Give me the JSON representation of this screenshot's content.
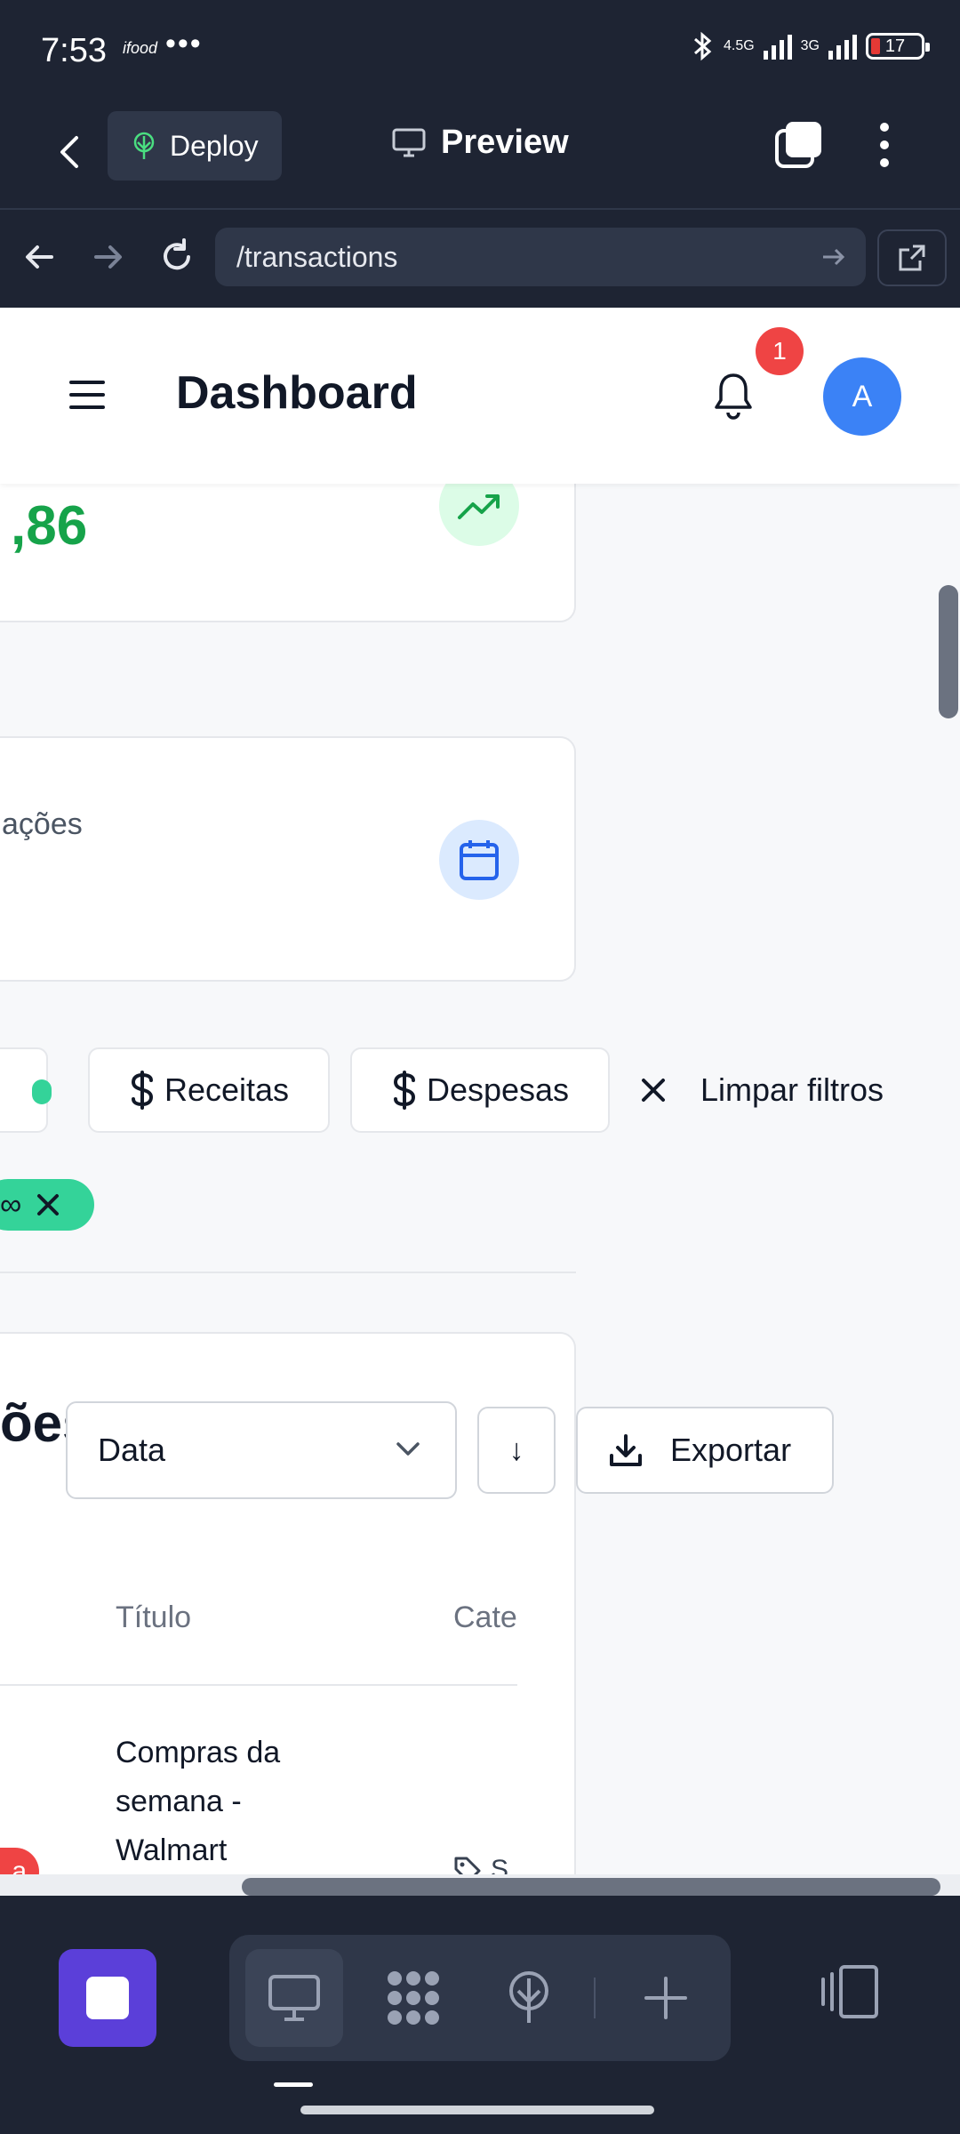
{
  "status_bar": {
    "time": "7:53",
    "app_icon_label": "ifood",
    "more": "•••",
    "network_1": "4.5G",
    "network_2": "3G",
    "battery": "17"
  },
  "toolbar": {
    "deploy_label": "Deploy",
    "preview_label": "Preview"
  },
  "browser": {
    "url": "/transactions"
  },
  "header": {
    "title": "Dashboard",
    "notification_count": "1",
    "avatar_initial": "A"
  },
  "summary": {
    "amount_partial": ",86",
    "count_label_partial": "ações"
  },
  "filters": {
    "chips": [
      {
        "label": "Receitas",
        "icon": "dollar-icon"
      },
      {
        "label": "Despesas",
        "icon": "dollar-icon"
      }
    ],
    "clear_label": "Limpar filtros",
    "active_tag": "∞"
  },
  "transactions": {
    "title_partial": "ões",
    "sort_value": "Data",
    "sort_direction": "↓",
    "export_label": "Exportar",
    "columns": [
      "Título",
      "Cate"
    ],
    "rows": [
      {
        "title": "Compras da semana - Walmart",
        "badge": "a",
        "category_partial": "S"
      }
    ]
  },
  "colors": {
    "accent_green": "#16a34a",
    "accent_blue": "#3b82f6",
    "danger": "#ef4444",
    "tag_green": "#34d399",
    "chrome_bg": "#1e2433",
    "stop_purple": "#5b3fd9"
  }
}
